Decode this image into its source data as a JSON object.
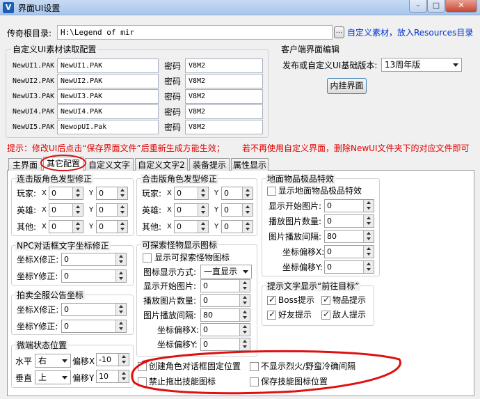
{
  "window": {
    "title": "界面UI设置",
    "icon_letter": "V"
  },
  "root": {
    "label": "传奇根目录:",
    "value": "H:\\Legend of mir",
    "browse": "...",
    "note": "自定义素材，放入Resources目录"
  },
  "custom_group": {
    "title": "自定义UI素材读取配置",
    "password_label": "密码",
    "rows": [
      {
        "name": "NewUI1.PAK",
        "file": "NewUI1.PAK",
        "password": "V8M2"
      },
      {
        "name": "NewUI2.PAK",
        "file": "NewUI2.PAK",
        "password": "V8M2"
      },
      {
        "name": "NewUI3.PAK",
        "file": "NewUI3.PAK",
        "password": "V8M2"
      },
      {
        "name": "NewUI4.PAK",
        "file": "NewUI4.PAK",
        "password": "V8M2"
      },
      {
        "name": "NewUI5.PAK",
        "file": "NewopUI.Pak",
        "password": "V8M2"
      }
    ]
  },
  "client": {
    "title": "客户端界面编辑",
    "version_label": "发布或自定义UI基础版本:",
    "version_value": "13周年版",
    "button": "内挂界面"
  },
  "tip": {
    "left": "提示：修改UI后点击“保存界面文件”后重新生成方能生效；",
    "right": "若不再使用自定义界面，删除NewUI文件夹下的对应文件即可"
  },
  "tabs": [
    "主界面",
    "其它配置",
    "自定义文字",
    "自定义文字2",
    "装备提示",
    "属性显示"
  ],
  "hair_lian": {
    "title": "连击版角色发型修正",
    "x": "X",
    "y": "Y",
    "rows": [
      {
        "label": "玩家:",
        "x": "0",
        "y": "0"
      },
      {
        "label": "英雄:",
        "x": "0",
        "y": "0"
      },
      {
        "label": "其他:",
        "x": "0",
        "y": "0"
      }
    ]
  },
  "hair_he": {
    "title": "合击版角色发型修正",
    "x": "X",
    "y": "Y",
    "rows": [
      {
        "label": "玩家:",
        "x": "0",
        "y": "0"
      },
      {
        "label": "英雄:",
        "x": "0",
        "y": "0"
      },
      {
        "label": "其他:",
        "x": "0",
        "y": "0"
      }
    ]
  },
  "npc": {
    "title": "NPC对话框文字坐标修正",
    "rows": [
      {
        "label": "坐标X修正:",
        "value": "0"
      },
      {
        "label": "坐标Y修正:",
        "value": "0"
      }
    ]
  },
  "auction": {
    "title": "拍卖全服公告坐标",
    "rows": [
      {
        "label": "坐标X修正:",
        "value": "0"
      },
      {
        "label": "坐标Y修正:",
        "value": "0"
      }
    ]
  },
  "micro": {
    "title": "微端状态位置",
    "h_label": "水平",
    "h_value": "右",
    "h_off_label": "偏移X",
    "h_off": "-10",
    "v_label": "垂直",
    "v_value": "上",
    "v_off_label": "偏移Y",
    "v_off": "10"
  },
  "monster": {
    "title": "可探索怪物显示图标",
    "checkbox": "显示可探索怪物图标",
    "mode_label": "图标显示方式:",
    "mode_value": "一直显示",
    "rows": [
      {
        "label": "显示开始图片:",
        "value": "0"
      },
      {
        "label": "播放图片数量:",
        "value": "0"
      },
      {
        "label": "图片播放间隔:",
        "value": "80"
      },
      {
        "label": "坐标偏移X:",
        "value": "0"
      },
      {
        "label": "坐标偏移Y:",
        "value": "0"
      }
    ]
  },
  "ground": {
    "title": "地面物品极品特效",
    "checkbox": "显示地面物品极品特效",
    "rows": [
      {
        "label": "显示开始图片:",
        "value": "0"
      },
      {
        "label": "播放图片数量:",
        "value": "0"
      },
      {
        "label": "图片播放间隔:",
        "value": "80"
      },
      {
        "label": "坐标偏移X:",
        "value": "0"
      },
      {
        "label": "坐标偏移Y:",
        "value": "0"
      }
    ]
  },
  "hint": {
    "title": "提示文字显示“前往目标”",
    "items": [
      {
        "label": "Boss提示",
        "checked": true
      },
      {
        "label": "物品提示",
        "checked": true
      },
      {
        "label": "好友提示",
        "checked": true
      },
      {
        "label": "敌人提示",
        "checked": true
      }
    ]
  },
  "bottom": {
    "items": [
      {
        "label": "创建角色对话框固定位置",
        "checked": false
      },
      {
        "label": "不显示烈火/野蛮冷确间隔",
        "checked": false
      },
      {
        "label": "禁止拖出技能图标",
        "checked": false
      },
      {
        "label": "保存技能图标位置",
        "checked": false
      }
    ]
  },
  "colors": {
    "annotation": "#e01010",
    "tip": "#e00000",
    "link": "#0033cc"
  }
}
